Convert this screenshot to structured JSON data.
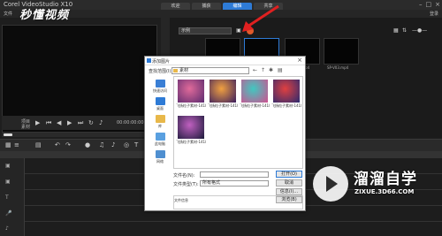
{
  "app": {
    "title": "Corel VideoStudio X10",
    "menu": "文件",
    "user": "登录"
  },
  "tabs": [
    {
      "label": "欢迎"
    },
    {
      "label": "捕获"
    },
    {
      "label": "编辑"
    },
    {
      "label": "共享"
    }
  ],
  "watermark_top": "秒懂视频",
  "library": {
    "dropdown": "示例",
    "thumbs": [
      {
        "label": ""
      },
      {
        "label": ""
      },
      {
        "label": "SP-V01.mp4"
      },
      {
        "label": "SP-V03.mp4"
      }
    ]
  },
  "preview": {
    "project_label": "项目",
    "clip_label": "素材",
    "timecode": "00:00:00:00"
  },
  "dialog": {
    "title": "添加图片",
    "look_in_label": "查找范围(I):",
    "look_in_value": "素材",
    "places": [
      {
        "label": "快速访问",
        "icon": "star-icon",
        "color": "#3a7fd5"
      },
      {
        "label": "桌面",
        "icon": "desktop-icon",
        "color": "#2e7bd6"
      },
      {
        "label": "库",
        "icon": "library-icon",
        "color": "#e8b84a"
      },
      {
        "label": "此电脑",
        "icon": "computer-icon",
        "color": "#5aa0e0"
      },
      {
        "label": "网络",
        "icon": "network-icon",
        "color": "#4f8fd0"
      }
    ],
    "files": [
      {
        "name": "飞扬粒子素材-1418047686...",
        "colors": [
          "#e06a9a",
          "#5a2a6e"
        ]
      },
      {
        "name": "飞扬粒子素材-1418046403...",
        "colors": [
          "#f0a040",
          "#3a1d5e"
        ]
      },
      {
        "name": "飞扬粒子素材-1418046516...",
        "colors": [
          "#40c8c0",
          "#d05090"
        ]
      },
      {
        "name": "飞扬粒子素材-1418046872...",
        "colors": [
          "#e04040",
          "#2a2a70"
        ]
      },
      {
        "name": "飞扬粒子素材-1418046885...",
        "colors": [
          "#c060c0",
          "#1a1a3a"
        ]
      }
    ],
    "filename_label": "文件名(N):",
    "filename_value": "",
    "filetype_label": "文件类型(T):",
    "filetype_value": "所有格式",
    "open_label": "打开(O)",
    "cancel_label": "取消",
    "info_label": "信息(I)...",
    "browse_label": "浏览(B)",
    "fileinfo_label": "文件信息"
  },
  "watermark_bottom": {
    "text": "溜溜自学",
    "url": "ZIXUE.3D66.COM"
  }
}
